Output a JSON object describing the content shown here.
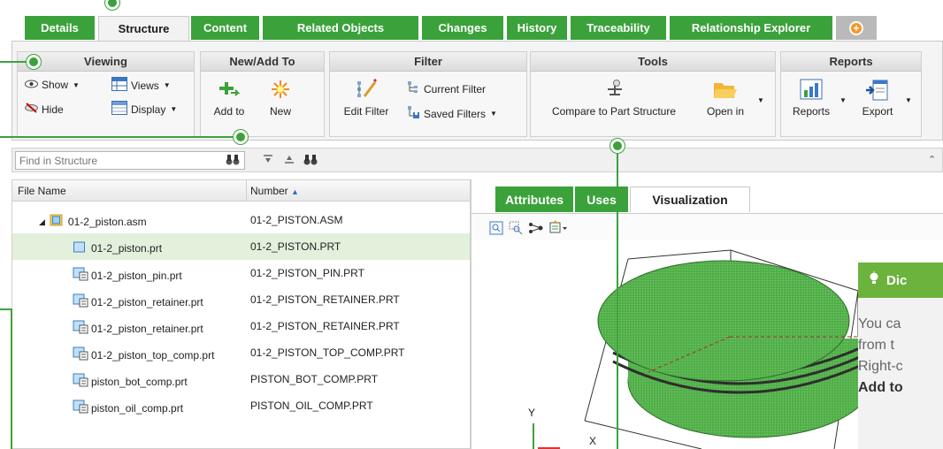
{
  "tabs": [
    {
      "label": "Details"
    },
    {
      "label": "Structure"
    },
    {
      "label": "Content"
    },
    {
      "label": "Related Objects"
    },
    {
      "label": "Changes"
    },
    {
      "label": "History"
    },
    {
      "label": "Traceability"
    },
    {
      "label": "Relationship Explorer"
    }
  ],
  "ribbon": {
    "viewing": {
      "title": "Viewing",
      "show": "Show",
      "hide": "Hide",
      "views": "Views",
      "display": "Display"
    },
    "new_add": {
      "title": "New/Add To",
      "add_to": "Add to",
      "new": "New"
    },
    "filter": {
      "title": "Filter",
      "edit_filter": "Edit Filter",
      "current_filter": "Current Filter",
      "saved_filters": "Saved Filters"
    },
    "tools": {
      "title": "Tools",
      "compare": "Compare to Part Structure",
      "open_in": "Open in"
    },
    "reports": {
      "title": "Reports",
      "reports": "Reports",
      "export": "Export"
    }
  },
  "search": {
    "placeholder": "Find in Structure"
  },
  "tree": {
    "columns": {
      "file_name": "File Name",
      "number": "Number"
    },
    "rows": [
      {
        "name": "01-2_piston.asm",
        "number": "01-2_PISTON.ASM"
      },
      {
        "name": "01-2_piston.prt",
        "number": "01-2_PISTON.PRT"
      },
      {
        "name": "01-2_piston_pin.prt",
        "number": "01-2_PISTON_PIN.PRT"
      },
      {
        "name": "01-2_piston_retainer.prt",
        "number": "01-2_PISTON_RETAINER.PRT"
      },
      {
        "name": "01-2_piston_retainer.prt",
        "number": "01-2_PISTON_RETAINER.PRT"
      },
      {
        "name": "01-2_piston_top_comp.prt",
        "number": "01-2_PISTON_TOP_COMP.PRT"
      },
      {
        "name": "piston_bot_comp.prt",
        "number": "PISTON_BOT_COMP.PRT"
      },
      {
        "name": "piston_oil_comp.prt",
        "number": "PISTON_OIL_COMP.PRT"
      }
    ]
  },
  "right_panel": {
    "tabs": [
      {
        "label": "Attributes"
      },
      {
        "label": "Uses"
      },
      {
        "label": "Visualization"
      }
    ],
    "axis_y": "Y",
    "axis_x": "X"
  },
  "tip": {
    "title": "Dic",
    "line1": "You ca",
    "line2": "from t",
    "line3": "Right-c",
    "line4": "Add to"
  },
  "colors": {
    "accent_green": "#3ba23b",
    "tip_green": "#6cb33e",
    "selected_row": "#e3f0dc",
    "add_tab_orange": "#f19a2a"
  }
}
